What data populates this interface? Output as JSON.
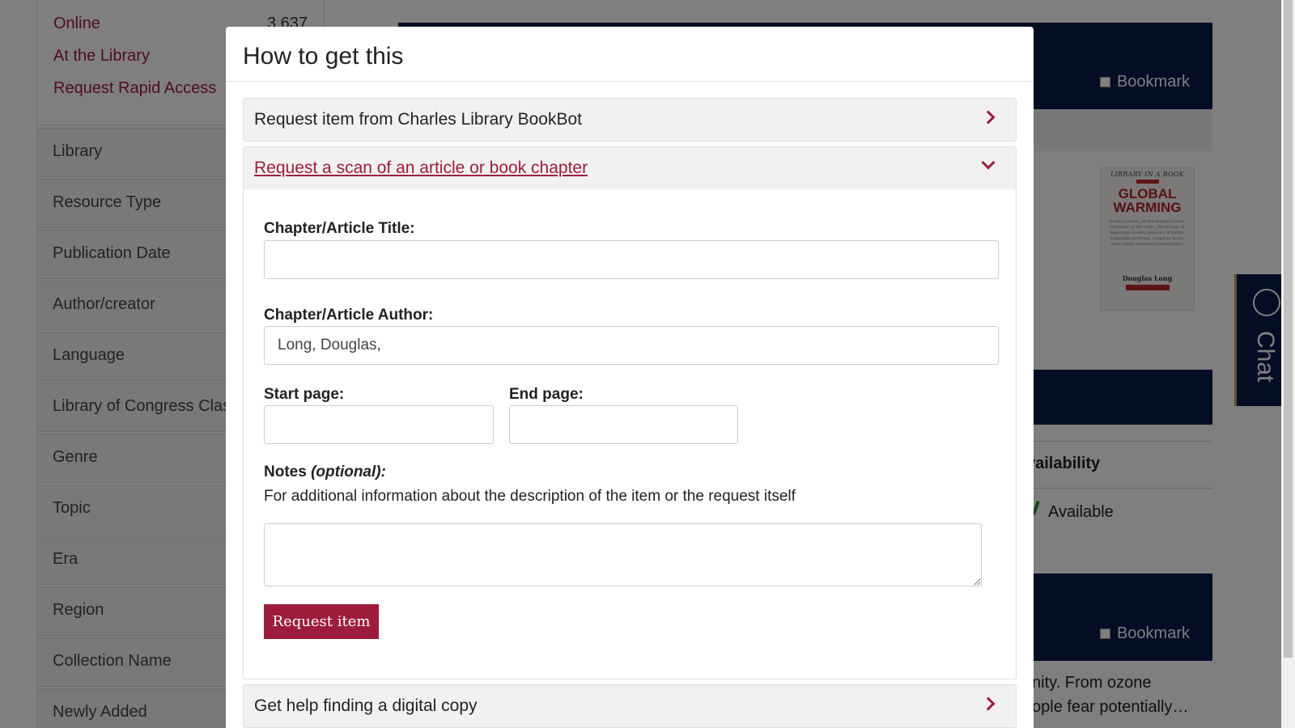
{
  "sidebar": {
    "availability": [
      {
        "label": "Online",
        "count": "3,637"
      },
      {
        "label": "At the Library"
      },
      {
        "label": "Request Rapid Access"
      }
    ],
    "facets": [
      "Library",
      "Resource Type",
      "Publication Date",
      "Author/creator",
      "Language",
      "Library of Congress Classification",
      "Genre",
      "Topic",
      "Era",
      "Region",
      "Collection Name",
      "Newly Added"
    ]
  },
  "record": {
    "bookmark_label": "Bookmark",
    "availability_heading": "vailability",
    "available_label": "Available",
    "description_line1": "nity. From ozone",
    "description_line2": "ople fear potentially…"
  },
  "cover": {
    "series": "LIBRARY IN A BOOK",
    "title_line1": "GLOBAL",
    "title_line2": "WARMING",
    "blurb": "In one volume, all the essential tools: Overview of the topic, chronology of important events, glossary of terms, biographical listing, complete index, plus a fully annotated bibliography",
    "author": "Douglas Long"
  },
  "chat": {
    "label": "Chat"
  },
  "modal": {
    "title": "How to get this",
    "sections": {
      "bookbot": "Request item from Charles Library BookBot",
      "scan": "Request a scan of an article or book chapter",
      "digital": "Get help finding a digital copy"
    },
    "form": {
      "title_label": "Chapter/Article Title:",
      "title_value": "",
      "author_label": "Chapter/Article Author:",
      "author_value": "Long, Douglas,",
      "start_label": "Start page:",
      "start_value": "",
      "end_label": "End page:",
      "end_value": "",
      "notes_label": "Notes ",
      "notes_optional": "(optional):",
      "notes_help": "For additional information about the description of the item or the request itself",
      "notes_value": "",
      "submit_label": "Request item"
    }
  },
  "colors": {
    "accent": "#9d1c3c",
    "navy": "#0b1a4a",
    "overlay": "rgba(0,0,0,0.5)"
  }
}
